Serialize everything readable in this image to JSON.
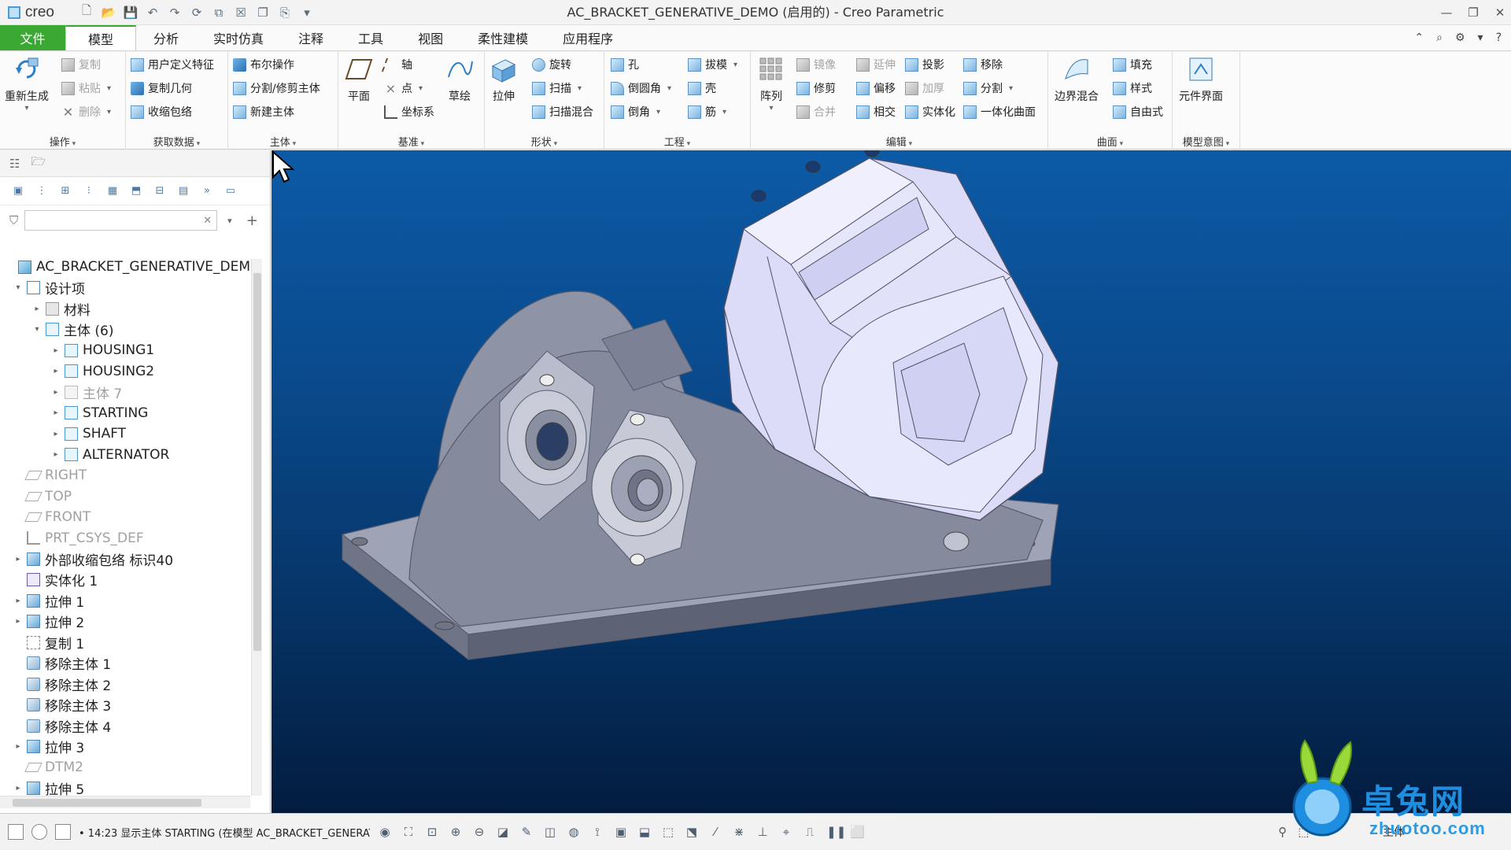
{
  "titlebar": {
    "logo": "creo",
    "title": "AC_BRACKET_GENERATIVE_DEMO (启用的) - Creo Parametric",
    "quick_access_icons": [
      "new-icon",
      "open-icon",
      "save-icon",
      "undo-icon",
      "redo-icon",
      "regenerate-icon",
      "window-icon",
      "close-window-icon",
      "copy-icon",
      "more-icon"
    ],
    "window_controls": [
      "minimize-icon",
      "restore-icon",
      "close-icon"
    ]
  },
  "tabs": {
    "file": "文件",
    "items": [
      "模型",
      "分析",
      "实时仿真",
      "注释",
      "工具",
      "视图",
      "柔性建模",
      "应用程序"
    ],
    "active": "模型"
  },
  "ribbon": {
    "operations": {
      "label": "操作",
      "regenerate": "重新生成",
      "copy": "复制",
      "paste": "粘贴",
      "delete": "删除"
    },
    "get_data": {
      "label": "获取数据",
      "udf": "用户定义特征",
      "copy_geom": "复制几何",
      "shrinkwrap": "收缩包络"
    },
    "body": {
      "label": "主体",
      "boolean": "布尔操作",
      "split_trim": "分割/修剪主体",
      "new_body": "新建主体"
    },
    "datum": {
      "label": "基准",
      "plane": "平面",
      "axis": "轴",
      "point": "点",
      "csys": "坐标系",
      "sketch": "草绘"
    },
    "shapes": {
      "label": "形状",
      "extrude": "拉伸",
      "revolve": "旋转",
      "sweep": "扫描",
      "swept_blend": "扫描混合"
    },
    "engineering": {
      "label": "工程",
      "hole": "孔",
      "round": "倒圆角",
      "chamfer": "倒角",
      "draft": "拔模",
      "shell": "壳",
      "rib": "筋"
    },
    "editing": {
      "label": "编辑",
      "pattern": "阵列",
      "mirror": "镜像",
      "trim": "修剪",
      "merge": "合并",
      "extend": "延伸",
      "offset": "偏移",
      "intersect": "相交",
      "project": "投影",
      "thicken": "加厚",
      "solidify": "实体化",
      "remove": "移除",
      "split": "分割",
      "unify_quilt": "一体化曲面"
    },
    "surfaces": {
      "label": "曲面",
      "boundary_blend": "边界混合",
      "fill": "填充",
      "style": "样式",
      "freestyle": "自由式"
    },
    "model_intent": {
      "label": "模型意图",
      "component_interface": "元件界面"
    }
  },
  "model_tree": {
    "search_placeholder": "",
    "rows": [
      {
        "label": "AC_BRACKET_GENERATIVE_DEM",
        "indent": 0,
        "expander": "",
        "icon": "part",
        "dim": false
      },
      {
        "label": "设计项",
        "indent": 0,
        "expander": "▾",
        "icon": "spec",
        "dim": false
      },
      {
        "label": "材料",
        "indent": 1,
        "expander": "▸",
        "icon": "folder",
        "dim": false
      },
      {
        "label": "主体 (6)",
        "indent": 1,
        "expander": "▾",
        "icon": "body",
        "dim": false
      },
      {
        "label": "HOUSING1",
        "indent": 2,
        "expander": "▸",
        "icon": "body",
        "dim": false
      },
      {
        "label": "HOUSING2",
        "indent": 2,
        "expander": "▸",
        "icon": "body",
        "dim": false
      },
      {
        "label": "主体 7",
        "indent": 2,
        "expander": "▸",
        "icon": "body",
        "dim": true
      },
      {
        "label": "STARTING",
        "indent": 2,
        "expander": "▸",
        "icon": "body",
        "dim": false
      },
      {
        "label": "SHAFT",
        "indent": 2,
        "expander": "▸",
        "icon": "body",
        "dim": false
      },
      {
        "label": "ALTERNATOR",
        "indent": 2,
        "expander": "▸",
        "icon": "body",
        "dim": false
      },
      {
        "label": "RIGHT",
        "indent": 0,
        "expander": "",
        "icon": "plane",
        "dim": true
      },
      {
        "label": "TOP",
        "indent": 0,
        "expander": "",
        "icon": "plane",
        "dim": true
      },
      {
        "label": "FRONT",
        "indent": 0,
        "expander": "",
        "icon": "plane",
        "dim": true
      },
      {
        "label": "PRT_CSYS_DEF",
        "indent": 0,
        "expander": "",
        "icon": "csys",
        "dim": true
      },
      {
        "label": "外部收缩包络 标识40",
        "indent": 0,
        "expander": "▸",
        "icon": "feat",
        "dim": false
      },
      {
        "label": "实体化 1",
        "indent": 0,
        "expander": "",
        "icon": "solid",
        "dim": false
      },
      {
        "label": "拉伸 1",
        "indent": 0,
        "expander": "▸",
        "icon": "feat",
        "dim": false
      },
      {
        "label": "拉伸 2",
        "indent": 0,
        "expander": "▸",
        "icon": "feat",
        "dim": false
      },
      {
        "label": "复制 1",
        "indent": 0,
        "expander": "",
        "icon": "copy",
        "dim": false
      },
      {
        "label": "移除主体 1",
        "indent": 0,
        "expander": "",
        "icon": "cut",
        "dim": false
      },
      {
        "label": "移除主体 2",
        "indent": 0,
        "expander": "",
        "icon": "cut",
        "dim": false
      },
      {
        "label": "移除主体 3",
        "indent": 0,
        "expander": "",
        "icon": "cut",
        "dim": false
      },
      {
        "label": "移除主体 4",
        "indent": 0,
        "expander": "",
        "icon": "cut",
        "dim": false
      },
      {
        "label": "拉伸 3",
        "indent": 0,
        "expander": "▸",
        "icon": "feat",
        "dim": false
      },
      {
        "label": "DTM2",
        "indent": 0,
        "expander": "",
        "icon": "plane",
        "dim": true
      },
      {
        "label": "拉伸 5",
        "indent": 0,
        "expander": "▸",
        "icon": "feat",
        "dim": false
      }
    ]
  },
  "status": {
    "message": "• 14:23 显示主体 STARTING (在模型 AC_BRACKET_GENERAT",
    "filter": "主体"
  },
  "watermark": {
    "brand": "卓兔网",
    "url": "zhuotoo.com"
  },
  "colors": {
    "accent": "#3aa833",
    "viewport_top": "#0c5aa6",
    "viewport_bottom": "#031c3e",
    "model_grey": "#8e93a6",
    "alternator": "#dcdcf8"
  }
}
